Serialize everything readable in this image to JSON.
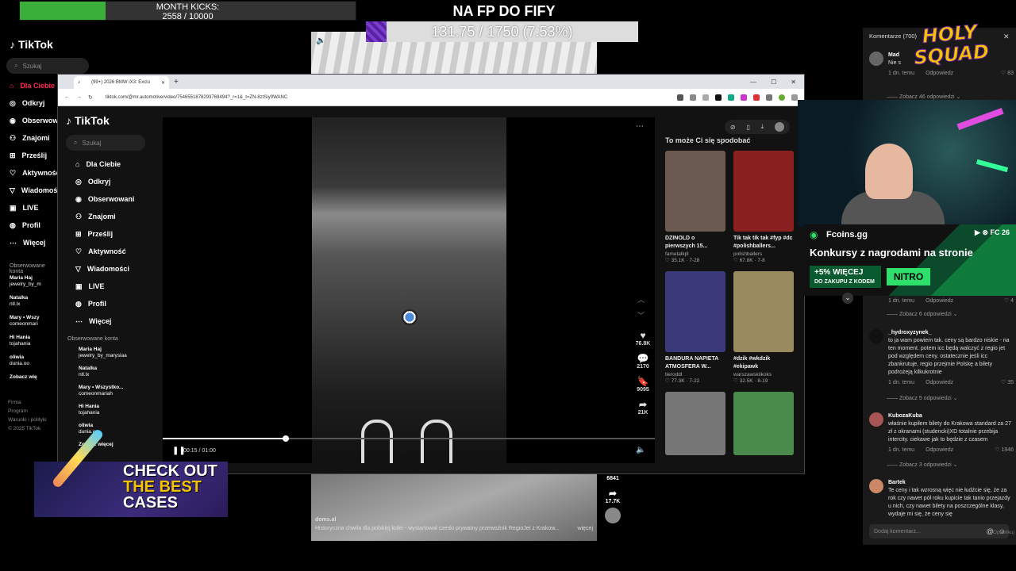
{
  "overlay": {
    "month_kicks_label": "MONTH KICKS:",
    "month_kicks_value": "2558 / 10000",
    "month_kicks_fraction": 0.2558,
    "goal_title": "NA FP DO FIFY",
    "goal_value": "131.75 / 1750 (7.53%)",
    "goal_fraction": 0.0753,
    "holy_squad_text": "HOLY SQUAD",
    "cases_line1": "CHECK OUT",
    "cases_line2": "THE BEST",
    "cases_line3": "CASES"
  },
  "bg_tiktok": {
    "logo": "TikTok",
    "search_placeholder": "Szukaj",
    "nav": [
      "Dla Ciebie",
      "Odkryj",
      "Obserwowani",
      "Znajomi",
      "Prześlij",
      "Aktywność",
      "Wiadomości",
      "LIVE",
      "Profil",
      "Więcej"
    ],
    "followed_title": "Obserwowane konta",
    "followed": [
      {
        "name": "Maria Haj",
        "handle": "jewelry_by_m"
      },
      {
        "name": "Natalka",
        "handle": "ntl.lx"
      },
      {
        "name": "Mary • Wszy",
        "handle": "comeonmari"
      },
      {
        "name": "Hi Hania",
        "handle": "tojahania"
      },
      {
        "name": "oliwia",
        "handle": "dunia.oo"
      }
    ],
    "see_more": "Zobacz wię",
    "footer": [
      "Firma",
      "Program",
      "Warunki i polityki",
      "© 2025 TikTok"
    ],
    "video_author": "doms.al",
    "video_caption": "Historyczna chwila dla polskiej kolei - wystartował czeski prywatny przewoźnik RegioJet z Krakow...",
    "video_caption_more": "więcej",
    "side_counts": [
      "6841",
      "17.7K"
    ]
  },
  "browser": {
    "tab_title": "(99+) 2026 BMW iX3: Exclu",
    "url": "tiktok.com/@mr.automotive/video/7546551878293769494?_r=1&_t=ZN-8ztSiy9WANC",
    "logo": "TikTok",
    "search_placeholder": "Szukaj",
    "nav": [
      "Dla Ciebie",
      "Odkryj",
      "Obserwowani",
      "Znajomi",
      "Prześlij",
      "Aktywność",
      "Wiadomości",
      "LIVE",
      "Profil",
      "Więcej"
    ],
    "followed_title": "Obserwowane konta",
    "followed": [
      {
        "name": "Maria Haj",
        "handle": "jewelry_by_marysiaa"
      },
      {
        "name": "Natalka",
        "handle": "ntl.lx"
      },
      {
        "name": "Mary • Wszystko...",
        "handle": "comeonmariah"
      },
      {
        "name": "Hi Hania",
        "handle": "tojahania"
      },
      {
        "name": "oliwia",
        "handle": "dunia.oo"
      }
    ],
    "see_more": "Zobacz więcej",
    "time": "00:15 / 01:00",
    "progress_fraction": 0.25,
    "likes": "76.8K",
    "comments": "2170",
    "saves": "9095",
    "shares": "21K",
    "reco_title": "To może Ci się spodobać",
    "reco": [
      {
        "caption": "DZINOLD o pierwszych 15...",
        "author": "fametalkpl",
        "meta": "35.1K · 7-28",
        "color": "#6b5a50"
      },
      {
        "caption": "Tik tak tik tak #fyp #dc #polishballers...",
        "author": "polishballers",
        "meta": "67.8K · 7-8",
        "color": "#8a2020"
      },
      {
        "caption": "BANDURA NAPIETA ATMOSFERA W...",
        "author": "tieroddl",
        "meta": "77.3K · 7-22",
        "color": "#3a3a7a"
      },
      {
        "caption": "#dzik #wkdzik #ekipawk",
        "author": "warszawskiikoks",
        "meta": "32.5K · 8-19",
        "color": "#9a8a60"
      },
      {
        "caption": "",
        "author": "",
        "meta": "",
        "color": "#777"
      },
      {
        "caption": "",
        "author": "",
        "meta": "",
        "color": "#4a8a4a"
      }
    ]
  },
  "comments_panel": {
    "header": "Komentarze (700)",
    "items": [
      {
        "user": "Mad",
        "text": "Nie s",
        "date": "1 dn. temu",
        "reply": "Odpowiedz",
        "likes": "83",
        "replies": "Zobacz 46 odpowiedzi"
      },
      {
        "user": "",
        "text": "",
        "date": "1 dn. temu",
        "reply": "Odpowiedz",
        "likes": "4",
        "replies": "Zobacz 6 odpowiedzi"
      },
      {
        "user": "_hydroxyzynek_",
        "text": "to ja wam powiem tak. ceny są bardzo niskie - na ten moment. potem icc będą walczyć z regio jet pod względem ceny. ostatecznie jeśli icc zbankrutuje, regio przejmie Polskę a bilety podrożeją kilkukrotnie",
        "date": "1 dn. temu",
        "reply": "Odpowiedz",
        "likes": "35",
        "replies": "Zobacz 5 odpowiedzi"
      },
      {
        "user": "KubozaKuba",
        "text": "właśnie kupiłem bilety do Krakowa standard za 27 zł z okranami (studencki)XD totalnie przebija intercity. ciekawe jak to będzie z czasem",
        "date": "1 dn. temu",
        "reply": "Odpowiedz",
        "likes": "1946",
        "replies": "Zobacz 3 odpowiedzi"
      },
      {
        "user": "Bartek",
        "text": "Te ceny i tak wzrosną więc nie łudźcie się, że za rok czy nawet pół roku kupicie tak tanio przejazdy u nich, czy nawet bilety na poszczególne klasy, wydaje mi się, że ceny się",
        "date": "",
        "reply": "",
        "likes": "",
        "replies": ""
      }
    ],
    "input_placeholder": "Dodaj komentarz...",
    "publish": "Opublikuj"
  },
  "sponsor": {
    "brand": "Fcoins.gg",
    "platforms": "FC 26",
    "headline": "Konkursy z nagrodami na stronie",
    "bonus": "+5% WIĘCEJ",
    "bonus_sub": "DO ZAKUPU Z KODEM",
    "code": "NITRO"
  }
}
